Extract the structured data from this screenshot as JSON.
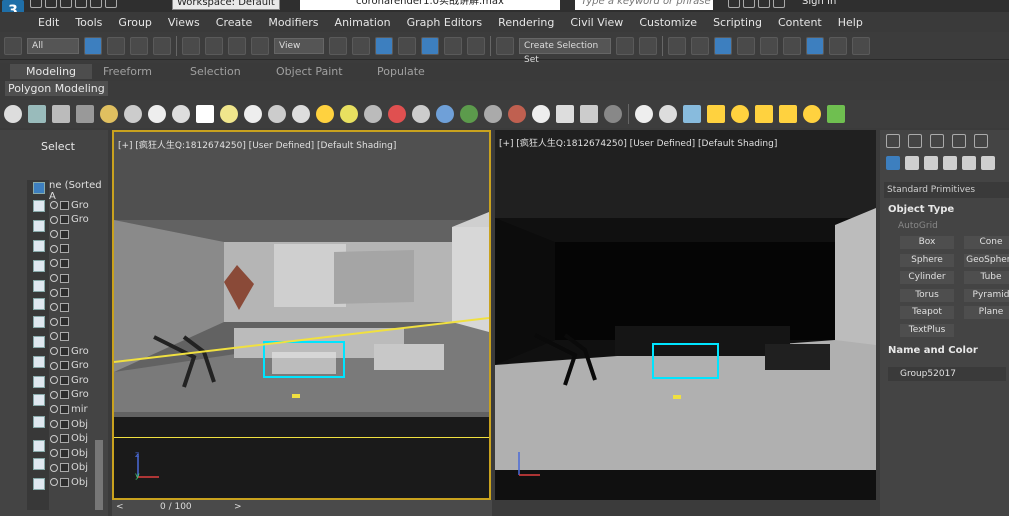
{
  "titlebar": {
    "workspace": "Workspace: Default",
    "document": "coronarender1.0实战讲解.max",
    "search_placeholder": "Type a keyword or phrase",
    "sign_in": "Sign In"
  },
  "menu": [
    "Edit",
    "Tools",
    "Group",
    "Views",
    "Create",
    "Modifiers",
    "Animation",
    "Graph Editors",
    "Rendering",
    "Civil View",
    "Customize",
    "Scripting",
    "Content",
    "Help"
  ],
  "toolbar": {
    "filter": "All",
    "view": "View",
    "selection_set": "Create Selection Set"
  },
  "ribbon": {
    "tabs": [
      "Modeling",
      "Freeform",
      "Selection",
      "Object Paint",
      "Populate"
    ],
    "active": "Modeling",
    "sub": "Polygon Modeling"
  },
  "scene_explorer": {
    "label": "Select",
    "header": "ne (Sorted A",
    "rows": [
      "Gro",
      "Gro",
      "",
      "",
      "",
      "",
      "",
      "",
      "",
      "",
      "Gro",
      "Gro",
      "Gro",
      "Gro",
      "mir",
      "Obj",
      "Obj",
      "Obj",
      "Obj",
      "Obj"
    ]
  },
  "viewports": {
    "left_label": "[+] [疯狂人生Q:1812674250] [User Defined] [Default Shading]",
    "right_label": "[+] [疯狂人生Q:1812674250] [User Defined] [Default Shading]",
    "axis_x": "x",
    "axis_y": "y",
    "axis_z": "z"
  },
  "timeline": {
    "counter": "0 / 100",
    "prev": "<",
    "next": ">"
  },
  "command_panel": {
    "category": "Standard Primitives",
    "object_type_title": "Object Type",
    "autogrid": "AutoGrid",
    "buttons": [
      "Box",
      "Cone",
      "Sphere",
      "GeoSphere",
      "Cylinder",
      "Tube",
      "Torus",
      "Pyramid",
      "Teapot",
      "Plane",
      "TextPlus"
    ],
    "name_color_title": "Name and Color",
    "object_name": "Group52017"
  },
  "colors": {
    "accent": "#3d7fbf",
    "viewport_selected_border": "#c9a21e",
    "selection_outline": "#00e5ff"
  }
}
